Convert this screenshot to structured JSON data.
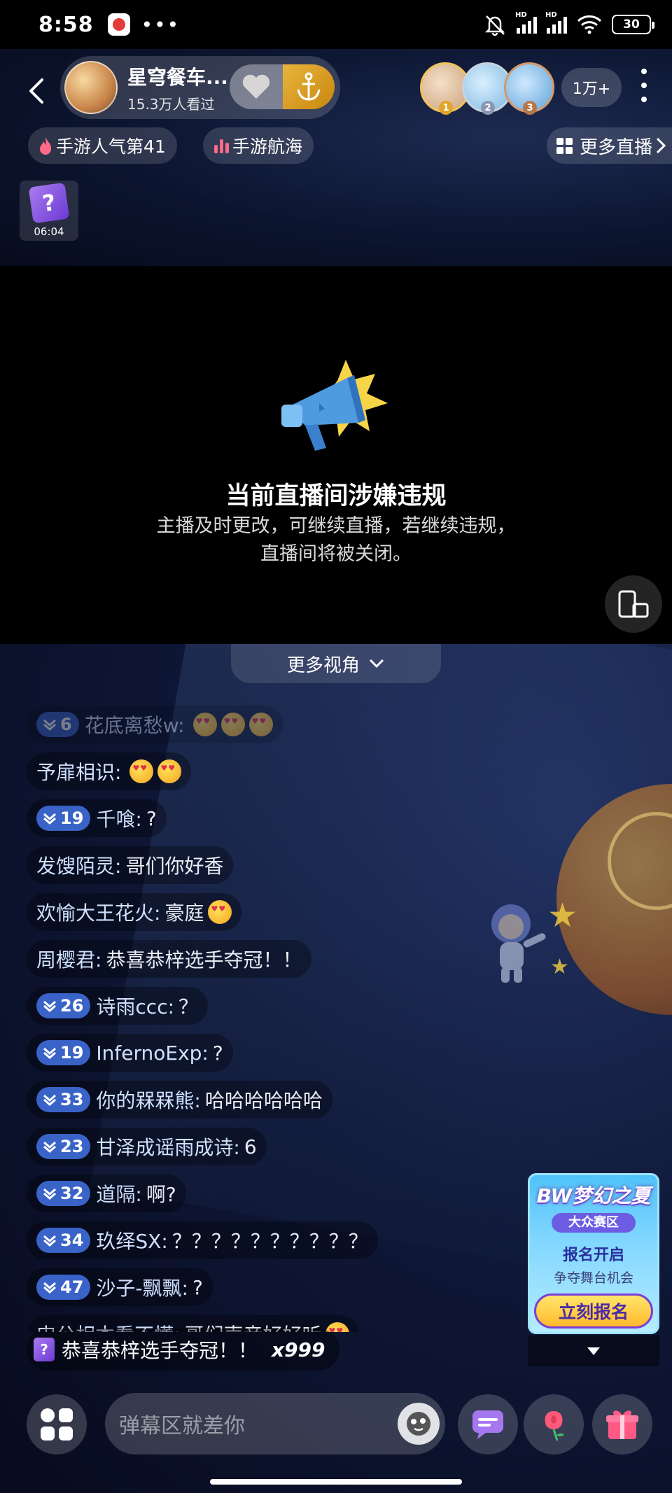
{
  "status_bar": {
    "time": "8:58",
    "dots": "•••",
    "battery": "30",
    "hd": "HD"
  },
  "header": {
    "anchor_name": "星穹餐车...",
    "viewers": "15.3万人看过",
    "audience_count": "1万+",
    "ranks": [
      "1",
      "2",
      "3"
    ]
  },
  "chips": [
    {
      "label": "手游人气第41"
    },
    {
      "label": "手游航海"
    }
  ],
  "more_live": "更多直播",
  "mystery_box": {
    "time": "06:04",
    "glyph": "?"
  },
  "notice": {
    "title": "当前直播间涉嫌违规",
    "desc": "主播及时更改，可继续直播，若继续违规，直播间将被关闭。"
  },
  "more_angles": "更多视角",
  "chat": [
    {
      "level": "6",
      "user": "花底离愁w:",
      "text": "",
      "emojis": 3
    },
    {
      "level": "",
      "user": "予扉相识:",
      "text": "",
      "emojis": 2
    },
    {
      "level": "19",
      "user": "千喰:",
      "text": "?",
      "emojis": 0
    },
    {
      "level": "",
      "user": "发馊陌灵:",
      "text": "哥们你好香",
      "emojis": 0
    },
    {
      "level": "",
      "user": "欢愉大王花火:",
      "text": "豪庭",
      "emojis": 1
    },
    {
      "level": "",
      "user": "周樱君:",
      "text": "恭喜恭梓选手夺冠！！",
      "emojis": 0
    },
    {
      "level": "26",
      "user": "诗雨ccc:",
      "text": "？",
      "emojis": 0
    },
    {
      "level": "19",
      "user": "InfernoExp:",
      "text": "?",
      "emojis": 0
    },
    {
      "level": "33",
      "user": "你的槑槑熊:",
      "text": "哈哈哈哈哈哈",
      "emojis": 0
    },
    {
      "level": "23",
      "user": "甘泽成谣雨成诗:",
      "text": "6",
      "emojis": 0
    },
    {
      "level": "32",
      "user": "道隔:",
      "text": "啊?",
      "emojis": 0
    },
    {
      "level": "34",
      "user": "玖绎SX:",
      "text": "？？？？？？？？？？",
      "emojis": 0
    },
    {
      "level": "47",
      "user": "沙子-飘飘:",
      "text": "?",
      "emojis": 0
    },
    {
      "level": "",
      "user": "申公相本看不懂:",
      "text": "哥们声音好好听",
      "emojis": 1
    }
  ],
  "gift_banner": {
    "text": "恭喜恭梓选手夺冠！！",
    "count": "x999",
    "glyph": "?"
  },
  "promo": {
    "logo": "BW梦幻之夏",
    "tag": "大众赛区",
    "open": "报名开启",
    "desc": "争夺舞台机会",
    "button": "立刻报名"
  },
  "input": {
    "placeholder": "弹幕区就差你"
  },
  "colors": {
    "badge": "#3a63c8",
    "accent_gold": "#f3c35b",
    "background": "#0c1530"
  }
}
